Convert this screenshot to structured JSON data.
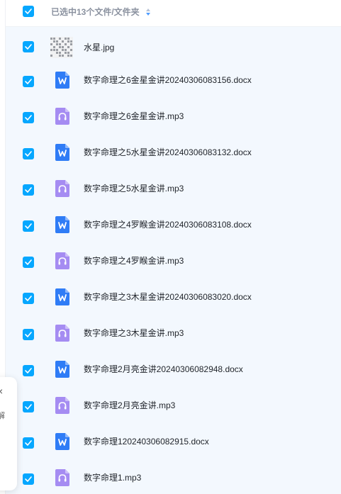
{
  "header": {
    "title": "已选中13个文件/文件夹",
    "all_selected": true,
    "sort_icon": "sort-updown-icon"
  },
  "colors": {
    "checkbox": "#06a7ff",
    "list_background": "#f3f8fe",
    "doc_icon": "#2f7cf6",
    "audio_icon": "#a58cf2"
  },
  "files": [
    {
      "name": "水星.jpg",
      "type": "image",
      "icon": "image-thumbnail-icon",
      "checked": true
    },
    {
      "name": "数字命理之6金星金讲20240306083156.docx",
      "type": "docx",
      "icon": "word-doc-icon",
      "checked": true
    },
    {
      "name": "数字命理之6金星金讲.mp3",
      "type": "mp3",
      "icon": "audio-file-icon",
      "checked": true
    },
    {
      "name": "数字命理之5水星金讲20240306083132.docx",
      "type": "docx",
      "icon": "word-doc-icon",
      "checked": true
    },
    {
      "name": "数字命理之5水星金讲.mp3",
      "type": "mp3",
      "icon": "audio-file-icon",
      "checked": true
    },
    {
      "name": "数字命理之4罗睺金讲20240306083108.docx",
      "type": "docx",
      "icon": "word-doc-icon",
      "checked": true
    },
    {
      "name": "数字命理之4罗睺金讲.mp3",
      "type": "mp3",
      "icon": "audio-file-icon",
      "checked": true
    },
    {
      "name": "数字命理之3木星金讲20240306083020.docx",
      "type": "docx",
      "icon": "word-doc-icon",
      "checked": true
    },
    {
      "name": "数字命理之3木星金讲.mp3",
      "type": "mp3",
      "icon": "audio-file-icon",
      "checked": true
    },
    {
      "name": "数字命理2月亮金讲20240306082948.docx",
      "type": "docx",
      "icon": "word-doc-icon",
      "checked": true
    },
    {
      "name": "数字命理2月亮金讲.mp3",
      "type": "mp3",
      "icon": "audio-file-icon",
      "checked": true
    },
    {
      "name": "数字命理120240306082915.docx",
      "type": "docx",
      "icon": "word-doc-icon",
      "checked": true
    },
    {
      "name": "数字命理1.mp3",
      "type": "mp3",
      "icon": "audio-file-icon",
      "checked": true
    }
  ],
  "side_panel": {
    "close_glyph": "×",
    "label": "解"
  }
}
